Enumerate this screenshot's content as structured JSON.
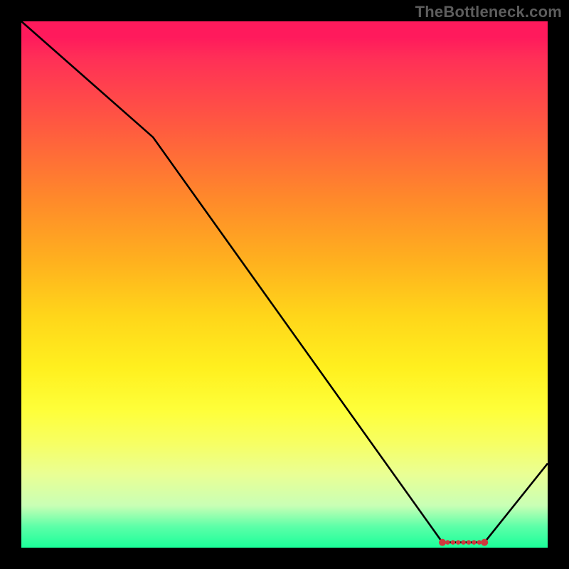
{
  "attribution": "TheBottleneck.com",
  "chart_data": {
    "type": "line",
    "title": "",
    "xlabel": "",
    "ylabel": "",
    "xlim": [
      0,
      100
    ],
    "ylim": [
      0,
      100
    ],
    "series": [
      {
        "name": "curve",
        "x": [
          0,
          25,
          80,
          88,
          100
        ],
        "y": [
          100,
          78,
          1,
          1,
          16
        ]
      }
    ],
    "markers": {
      "name": "band",
      "x": [
        80,
        81,
        82,
        83,
        84,
        85,
        86,
        87,
        88
      ],
      "y": [
        1,
        1,
        1,
        1,
        1,
        1,
        1,
        1,
        1
      ]
    },
    "gradient_stops": [
      {
        "pos": 0.0,
        "color": "#ff1a5c"
      },
      {
        "pos": 0.2,
        "color": "#ff5a40"
      },
      {
        "pos": 0.46,
        "color": "#ffb21e"
      },
      {
        "pos": 0.7,
        "color": "#feff3a"
      },
      {
        "pos": 0.92,
        "color": "#c9ffb5"
      },
      {
        "pos": 1.0,
        "color": "#1bff9a"
      }
    ]
  }
}
